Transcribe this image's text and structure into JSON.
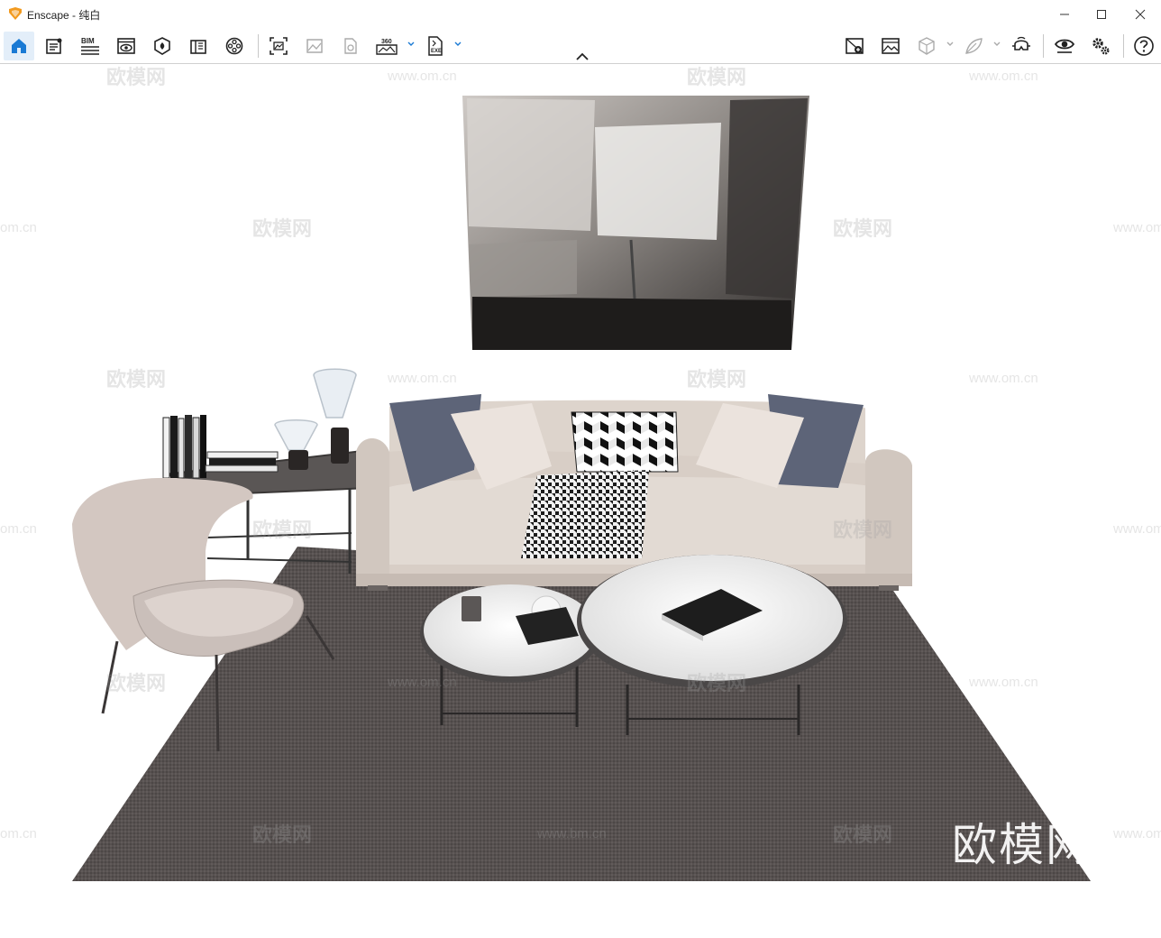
{
  "window": {
    "title": "Enscape - 纯白",
    "controls": [
      "minimize-icon",
      "maximize-icon",
      "close-icon"
    ]
  },
  "toolbar": {
    "left_icons": [
      "home-icon",
      "settings-list-icon",
      "bim-icon",
      "visibility-view-icon",
      "material-editor-icon",
      "asset-library-icon",
      "video-editor-icon",
      "screenshot-icon",
      "batch-render-icon",
      "panorama-icon",
      "panorama-360-icon",
      "export-exe-icon"
    ],
    "bim_label": "BIM",
    "pano_label": "360",
    "exe_label": "EXE",
    "right_icons": [
      "view-management-icon",
      "visual-settings-icon",
      "sync-views-icon",
      "material-sync-icon",
      "vr-headset-icon",
      "live-update-icon",
      "general-settings-icon",
      "help-icon"
    ]
  },
  "viewport": {
    "scene": "living-room-render",
    "watermark_brand": "欧模网",
    "watermark_url": "www.om.cn",
    "watermark_url_variant": "www.bm.cn",
    "watermark_domain_partial": "om.cn"
  },
  "colors": {
    "accent": "#1a7ad4",
    "logo_orange": "#f29a1f",
    "sofa": "#d9d0c8",
    "rug": "#555050",
    "pillow_navy": "#5d6478"
  }
}
